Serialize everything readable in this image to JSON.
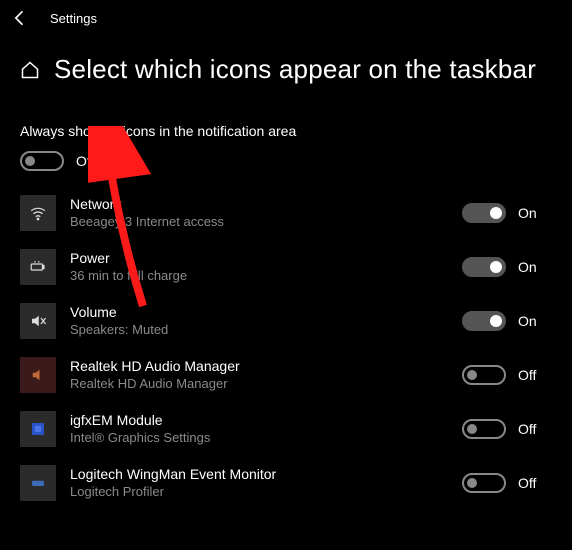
{
  "header": {
    "app_title": "Settings"
  },
  "page": {
    "title": "Select which icons appear on the taskbar"
  },
  "master_toggle": {
    "label": "Always show all icons in the notification area",
    "state_text": "Off",
    "on": false
  },
  "items": [
    {
      "title": "Network",
      "subtitle": "Beeagey 3 Internet access",
      "state_text": "On",
      "on": true,
      "icon": "network-icon",
      "icon_bg": "#2b2b2b"
    },
    {
      "title": "Power",
      "subtitle": "36 min to full charge",
      "state_text": "On",
      "on": true,
      "icon": "power-icon",
      "icon_bg": "#2b2b2b"
    },
    {
      "title": "Volume",
      "subtitle": "Speakers: Muted",
      "state_text": "On",
      "on": true,
      "icon": "volume-muted-icon",
      "icon_bg": "#2b2b2b"
    },
    {
      "title": "Realtek HD Audio Manager",
      "subtitle": "Realtek HD Audio Manager",
      "state_text": "Off",
      "on": false,
      "icon": "realtek-icon",
      "icon_bg": "#3a1a1a"
    },
    {
      "title": "igfxEM Module",
      "subtitle": "Intel® Graphics Settings",
      "state_text": "Off",
      "on": false,
      "icon": "intel-icon",
      "icon_bg": "#2b2b2b"
    },
    {
      "title": "Logitech WingMan Event Monitor",
      "subtitle": "Logitech Profiler",
      "state_text": "Off",
      "on": false,
      "icon": "logitech-icon",
      "icon_bg": "#2b2b2b"
    }
  ],
  "annotation": {
    "arrow_color": "#ff1a1a"
  }
}
